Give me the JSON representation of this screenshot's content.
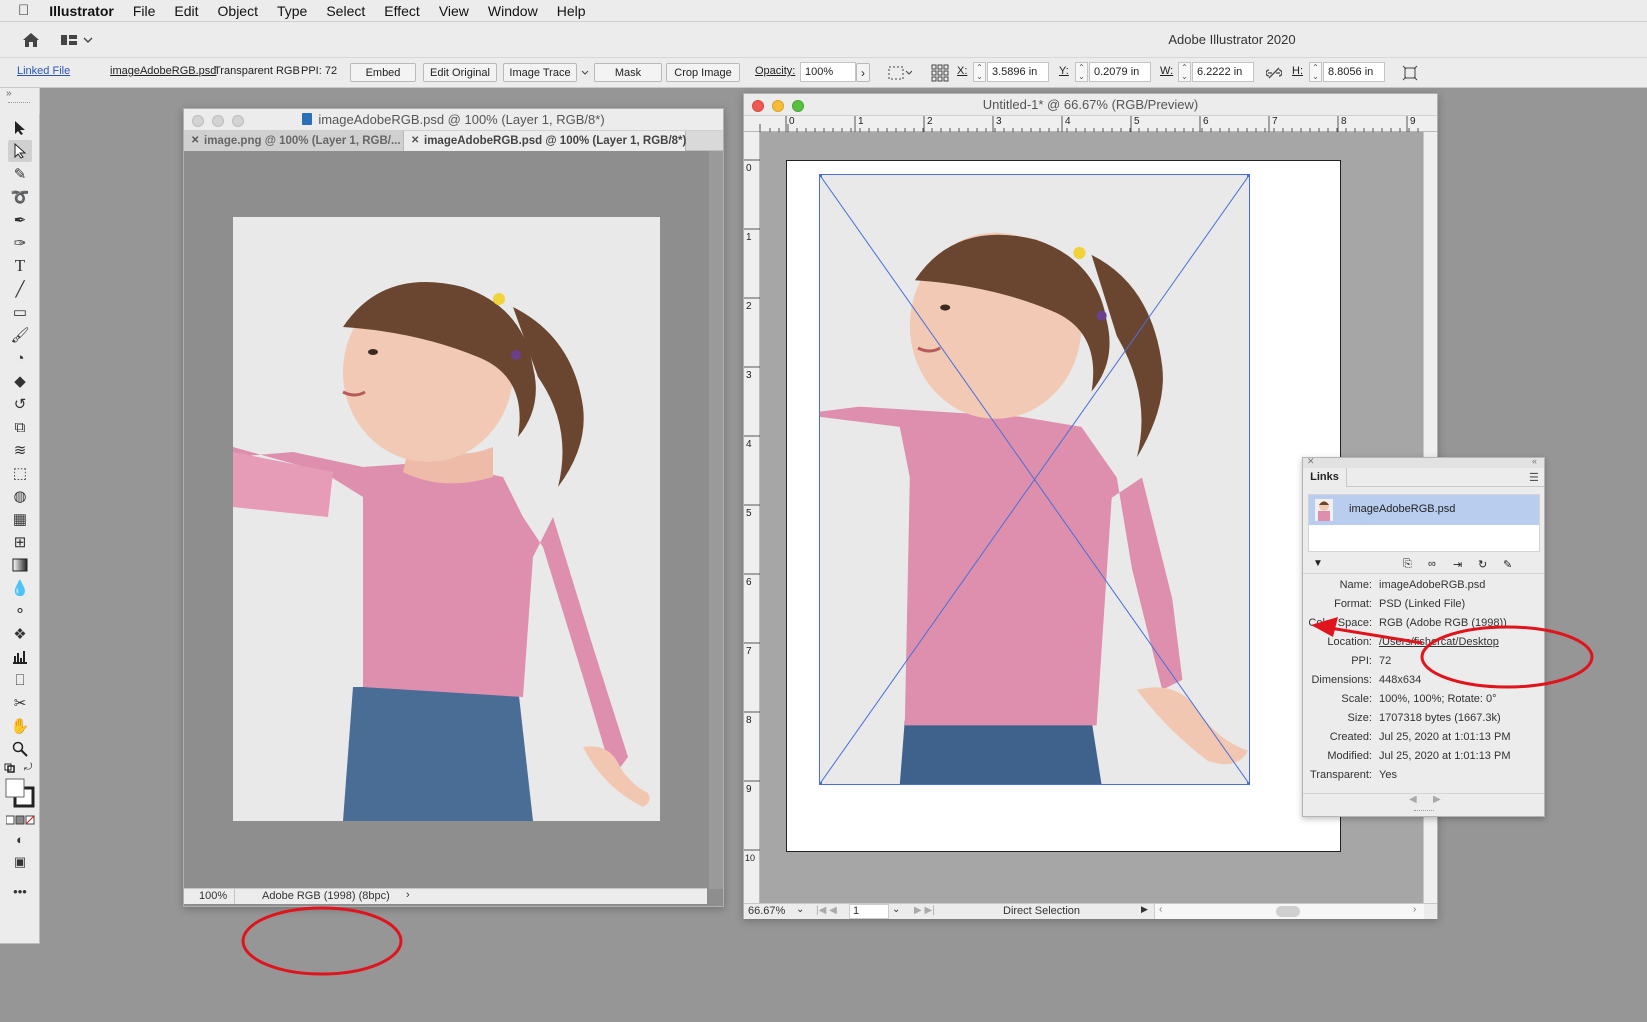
{
  "menubar": {
    "app": "Illustrator",
    "items": [
      "File",
      "Edit",
      "Object",
      "Type",
      "Select",
      "Effect",
      "View",
      "Window",
      "Help"
    ]
  },
  "appbar": {
    "title": "Adobe Illustrator 2020"
  },
  "control": {
    "linked_file": "Linked File",
    "file_name": "imageAdobeRGB.psd",
    "color_info": "Transparent RGB",
    "ppi": "PPI: 72",
    "embed": "Embed",
    "edit_original": "Edit Original",
    "image_trace": "Image Trace",
    "mask": "Mask",
    "crop_image": "Crop Image",
    "opacity_label": "Opacity:",
    "opacity_value": "100%",
    "x_label": "X:",
    "x_value": "3.5896 in",
    "y_label": "Y:",
    "y_value": "0.2079 in",
    "w_label": "W:",
    "w_value": "6.2222 in",
    "h_label": "H:",
    "h_value": "8.8056 in"
  },
  "tools": [
    "selection-tool",
    "direct-selection-tool",
    "magic-wand-tool",
    "lasso-tool",
    "pen-tool",
    "curvature-tool",
    "type-tool",
    "line-tool",
    "rectangle-tool",
    "paintbrush-tool",
    "shaper-tool",
    "eraser-tool",
    "rotate-tool",
    "scale-tool",
    "warp-tool",
    "free-transform-tool",
    "shape-builder-tool",
    "perspective-grid-tool",
    "mesh-tool",
    "gradient-tool",
    "eyedropper-tool",
    "blend-tool",
    "symbol-sprayer-tool",
    "column-graph-tool",
    "artboard-tool",
    "slice-tool",
    "hand-tool",
    "zoom-tool"
  ],
  "psdwin": {
    "title": "imageAdobeRGB.psd @ 100% (Layer 1, RGB/8*)",
    "tabs": [
      "image.png @ 100% (Layer 1, RGB/...",
      "imageAdobeRGB.psd @ 100% (Layer 1, RGB/8*)"
    ],
    "zoom": "100%",
    "profile": "Adobe RGB (1998) (8bpc)",
    "arrow": "›"
  },
  "aiwin": {
    "title": "Untitled-1* @ 66.67% (RGB/Preview)",
    "ruler_top": [
      "0",
      "1",
      "2",
      "3",
      "4",
      "5",
      "6",
      "7",
      "8",
      "9"
    ],
    "ruler_left": [
      "0",
      "1",
      "2",
      "3",
      "4",
      "5",
      "6",
      "7",
      "8",
      "9",
      "10"
    ],
    "zoom": "66.67%",
    "page": "1",
    "tool_status": "Direct Selection"
  },
  "links": {
    "title": "Links",
    "item": "imageAdobeRGB.psd",
    "rows": [
      {
        "k": "Name:",
        "v": "imageAdobeRGB.psd"
      },
      {
        "k": "Format:",
        "v": "PSD (Linked File)"
      },
      {
        "k": "Color Space:",
        "v": "RGB (Adobe RGB (1998))"
      },
      {
        "k": "Location:",
        "v": "/Users/fishercat/Desktop"
      },
      {
        "k": "PPI:",
        "v": "72"
      },
      {
        "k": "Dimensions:",
        "v": "448x634"
      },
      {
        "k": "Scale:",
        "v": "100%, 100%; Rotate: 0°"
      },
      {
        "k": "Size:",
        "v": "1707318 bytes (1667.3k)"
      },
      {
        "k": "Created:",
        "v": "Jul 25, 2020 at 1:01:13 PM"
      },
      {
        "k": "Modified:",
        "v": "Jul 25, 2020 at 1:01:13 PM"
      },
      {
        "k": "Transparent:",
        "v": "Yes"
      }
    ]
  },
  "colors": {
    "annotation": "#e0141c",
    "selection": "#4a6fd8",
    "link_highlight": "#b9cdee"
  }
}
